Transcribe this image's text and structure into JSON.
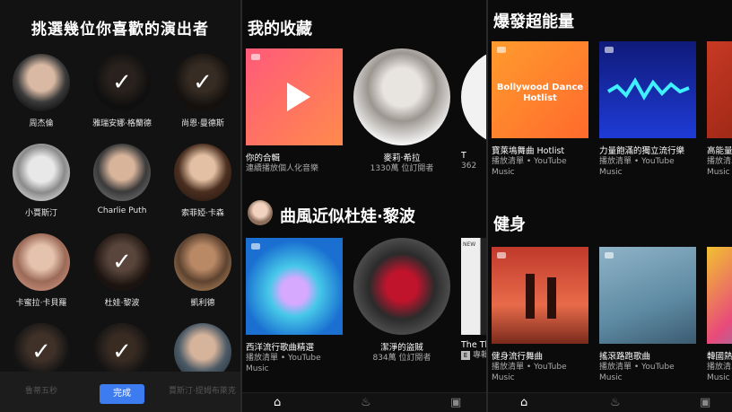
{
  "panel1": {
    "title": "挑選幾位你喜歡的演出者",
    "artists": [
      {
        "name": "周杰倫",
        "selected": false
      },
      {
        "name": "雅瑞安娜·格蘭德",
        "selected": true
      },
      {
        "name": "尚恩·曼德斯",
        "selected": true
      },
      {
        "name": "小賈斯汀",
        "selected": false
      },
      {
        "name": "Charlie Puth",
        "selected": false
      },
      {
        "name": "索菲婭·卡森",
        "selected": false
      },
      {
        "name": "卡蜜拉·卡貝羅",
        "selected": false
      },
      {
        "name": "杜娃·黎波",
        "selected": true
      },
      {
        "name": "凱利德",
        "selected": false
      },
      {
        "name": "",
        "selected": true
      },
      {
        "name": "",
        "selected": true
      },
      {
        "name": "",
        "selected": false
      }
    ],
    "footer_left": "魯蒂五秒",
    "footer_right": "賈斯汀·提姆布萊克",
    "done_label": "完成"
  },
  "panel2": {
    "section1_title": "我的收藏",
    "section1_cards": [
      {
        "title": "你的合輯",
        "subtitle": "連續播放個人化音樂"
      },
      {
        "title": "麥莉·希拉",
        "subtitle": "1330萬 位訂閱者"
      },
      {
        "title": "T",
        "subtitle": "362"
      }
    ],
    "section2_title": "曲風近似杜娃·黎波",
    "section2_cards": [
      {
        "title": "西洋流行歌曲精選",
        "subtitle": "播放清單 • YouTube Music"
      },
      {
        "title": "潔淨的盜賊",
        "subtitle": "834萬 位訂閱者"
      },
      {
        "title": "The Th",
        "subtitle": "專輯"
      }
    ],
    "thumb_labels": {
      "new_label": "NEW"
    }
  },
  "panel3": {
    "section1_title": "爆發超能量",
    "section1_cards": [
      {
        "title": "寶萊塢舞曲 Hotlist",
        "subtitle": "播放清單 • YouTube Music",
        "cover_text": "Bollywood Dance Hotlist"
      },
      {
        "title": "力量飽滿的獨立流行樂",
        "subtitle": "播放清單 • YouTube Music"
      },
      {
        "title": "高能量",
        "subtitle": "播放清單 • YouTube Music"
      }
    ],
    "section2_title": "健身",
    "section2_cards": [
      {
        "title": "健身流行舞曲",
        "subtitle": "播放清單 • YouTube Music"
      },
      {
        "title": "搖滾路跑歌曲",
        "subtitle": "播放清單 • YouTube Music"
      },
      {
        "title": "韓國熱",
        "subtitle": "播放清單 • YouTube Music"
      }
    ]
  },
  "nav": {
    "home_icon": "home-icon",
    "hot_icon": "hotlist-icon",
    "library_icon": "library-icon"
  },
  "colors": {
    "accent": "#3d7bf0",
    "background": "#0b0b0b"
  }
}
